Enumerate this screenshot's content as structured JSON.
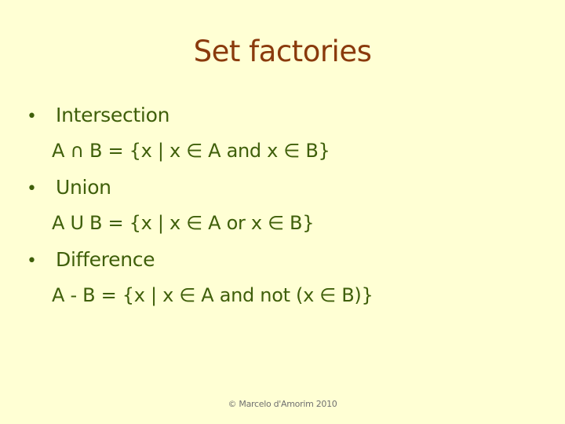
{
  "slide": {
    "title": "Set factories",
    "bullet_glyph": "•",
    "items": [
      {
        "label": "Intersection",
        "formula": "A ∩ B = {x | x ∈ A and x ∈ B}"
      },
      {
        "label": "Union",
        "formula": "A U B = {x | x ∈ A or x ∈ B}"
      },
      {
        "label": "Difference",
        "formula": "A - B = {x | x ∈ A and not (x ∈ B)}"
      }
    ],
    "footer": "© Marcelo d'Amorim 2010"
  },
  "colors": {
    "background": "#ffffd4",
    "title": "#8a3a0c",
    "body_text": "#3f5f0a",
    "footer": "#707070"
  }
}
